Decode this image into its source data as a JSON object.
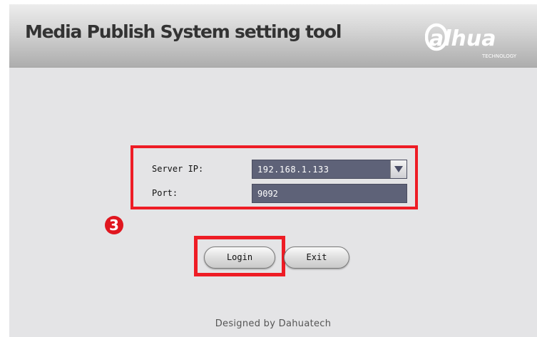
{
  "header": {
    "title": "Media Publish System setting tool",
    "logo_text": "alhua",
    "logo_subtext": "TECHNOLOGY"
  },
  "form": {
    "server_ip_label": "Server IP:",
    "server_ip_value": "192.168.1.133",
    "port_label": "Port:",
    "port_value": "9092"
  },
  "annotation": {
    "step_number": "3"
  },
  "buttons": {
    "login_label": "Login",
    "exit_label": "Exit"
  },
  "footer": {
    "text": "Designed by Dahuatech"
  },
  "colors": {
    "highlight": "#ee1c25",
    "field_bg": "#5e6278",
    "panel_bg": "#e4e4e6"
  }
}
